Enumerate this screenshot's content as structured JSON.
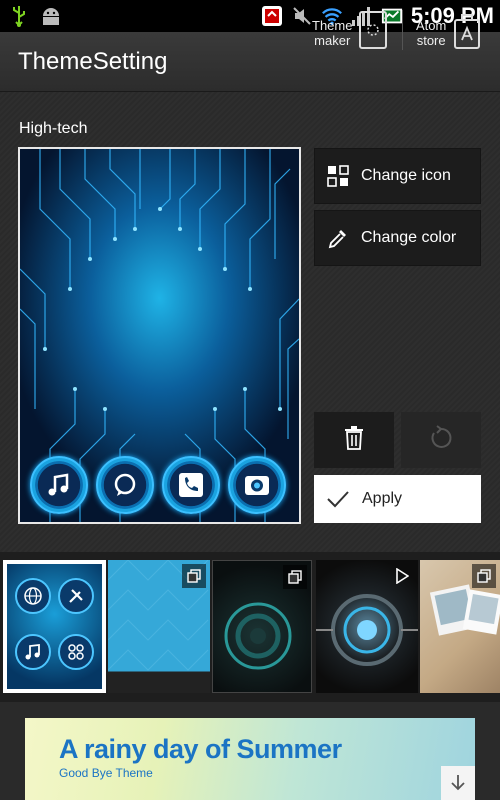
{
  "status_bar": {
    "time": "5:09 PM",
    "icons": [
      "usb-icon",
      "android-debug-icon",
      "missed-call-icon",
      "mute-icon",
      "wifi-icon",
      "signal-icon",
      "battery-icon"
    ]
  },
  "header": {
    "title": "ThemeSetting",
    "theme_maker_label": "Theme\nmaker",
    "atom_store_label": "Atom\nstore"
  },
  "theme": {
    "name": "High-tech"
  },
  "actions": {
    "change_icon": "Change icon",
    "change_color": "Change color",
    "apply": "Apply"
  },
  "thumbnails": [
    {
      "id": "high-tech",
      "selected": true
    },
    {
      "id": "blue-triangles",
      "badge": "copy-icon"
    },
    {
      "id": "dark-circle",
      "badge": "copy-icon"
    },
    {
      "id": "tech-orb",
      "badge": "play-icon"
    },
    {
      "id": "memory-photos",
      "badge": "copy-icon"
    }
  ],
  "banner": {
    "title": "A rainy day of Summer",
    "subtitle": "Good Bye Theme"
  },
  "colors": {
    "accent": "#1aa3e0",
    "banner_text": "#1b74c4",
    "background": "#2b2b2b"
  }
}
